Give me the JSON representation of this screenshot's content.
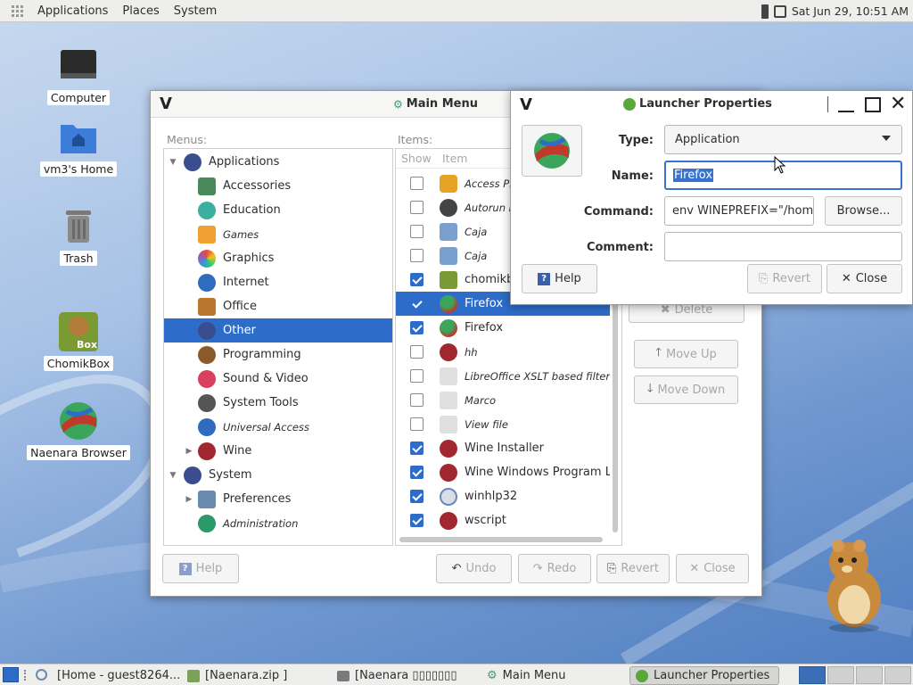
{
  "top_panel": {
    "menus": [
      "Applications",
      "Places",
      "System"
    ],
    "clock": "Sat Jun 29, 10:51 AM"
  },
  "desktop": {
    "icons": [
      {
        "label": "Computer",
        "icon": "computer-icon"
      },
      {
        "label": "vm3's Home",
        "icon": "home-folder-icon"
      },
      {
        "label": "Trash",
        "icon": "trash-icon"
      },
      {
        "label": "ChomikBox",
        "icon": "chomikbox-icon"
      },
      {
        "label": "Naenara Browser",
        "icon": "naenara-browser-icon"
      }
    ]
  },
  "main_menu": {
    "title": "Main Menu",
    "menus_label": "Menus:",
    "items_label": "Items:",
    "col_show": "Show",
    "col_item": "Item",
    "tree": [
      {
        "label": "Applications",
        "level": 0,
        "expanded": true,
        "icon": "applications-icon"
      },
      {
        "label": "Accessories",
        "level": 1,
        "icon": "accessories-icon"
      },
      {
        "label": "Education",
        "level": 1,
        "icon": "education-icon"
      },
      {
        "label": "Games",
        "level": 1,
        "icon": "games-icon",
        "italic": true
      },
      {
        "label": "Graphics",
        "level": 1,
        "icon": "graphics-icon"
      },
      {
        "label": "Internet",
        "level": 1,
        "icon": "internet-icon"
      },
      {
        "label": "Office",
        "level": 1,
        "icon": "office-icon"
      },
      {
        "label": "Other",
        "level": 1,
        "icon": "other-icon",
        "selected": true
      },
      {
        "label": "Programming",
        "level": 1,
        "icon": "programming-icon"
      },
      {
        "label": "Sound & Video",
        "level": 1,
        "icon": "sound-video-icon"
      },
      {
        "label": "System Tools",
        "level": 1,
        "icon": "system-tools-icon"
      },
      {
        "label": "Universal Access",
        "level": 1,
        "icon": "universal-access-icon",
        "italic": true
      },
      {
        "label": "Wine",
        "level": 1,
        "icon": "wine-icon",
        "collapsed": true
      },
      {
        "label": "System",
        "level": 0,
        "expanded": true,
        "icon": "system-icon"
      },
      {
        "label": "Preferences",
        "level": 1,
        "icon": "preferences-icon",
        "collapsed": true
      },
      {
        "label": "Administration",
        "level": 1,
        "icon": "administration-icon",
        "italic": true
      }
    ],
    "items": [
      {
        "label": "Access Prompt",
        "checked": false,
        "italic": true,
        "icon": "shield-icon"
      },
      {
        "label": "Autorun Prompt",
        "checked": false,
        "italic": true,
        "icon": "gear-icon"
      },
      {
        "label": "Caja",
        "checked": false,
        "italic": true,
        "icon": "folder-icon"
      },
      {
        "label": "Caja",
        "checked": false,
        "italic": true,
        "icon": "folder-icon"
      },
      {
        "label": "chomikbox",
        "checked": true,
        "icon": "chomikbox-icon"
      },
      {
        "label": "Firefox",
        "checked": true,
        "icon": "naenara-icon",
        "selected": true
      },
      {
        "label": "Firefox",
        "checked": true,
        "icon": "naenara-icon"
      },
      {
        "label": "hh",
        "checked": false,
        "italic": true,
        "icon": "wine-icon"
      },
      {
        "label": "LibreOffice XSLT based filters",
        "checked": false,
        "italic": true,
        "icon": "blank-icon"
      },
      {
        "label": "Marco",
        "checked": false,
        "italic": true,
        "icon": "blank-icon"
      },
      {
        "label": "View file",
        "checked": false,
        "italic": true,
        "icon": "blank-icon"
      },
      {
        "label": "Wine Installer",
        "checked": true,
        "icon": "wine-icon"
      },
      {
        "label": "Wine Windows Program Loader",
        "checked": true,
        "icon": "wine-icon"
      },
      {
        "label": "winhlp32",
        "checked": true,
        "icon": "help-icon"
      },
      {
        "label": "wscript",
        "checked": true,
        "icon": "wine-icon"
      }
    ],
    "side_buttons": {
      "delete": "Delete",
      "move_up": "Move Up",
      "move_down": "Move Down"
    },
    "bottom_buttons": {
      "help": "Help",
      "undo": "Undo",
      "redo": "Redo",
      "revert": "Revert",
      "close": "Close"
    }
  },
  "launcher": {
    "title": "Launcher Properties",
    "type_label": "Type:",
    "type_value": "Application",
    "name_label": "Name:",
    "name_value": "Firefox",
    "command_label": "Command:",
    "command_value": "env WINEPREFIX=\"/hom",
    "comment_label": "Comment:",
    "comment_value": "",
    "browse": "Browse...",
    "help": "Help",
    "revert": "Revert",
    "close": "Close"
  },
  "taskbar": {
    "tasks": [
      {
        "label": "[Home - guest8264...",
        "icon": "folder-icon"
      },
      {
        "label": "[Naenara.zip ]",
        "icon": "archive-icon"
      },
      {
        "label": "[Naenara ▯▯▯▯▯▯▯",
        "icon": "folder-icon"
      },
      {
        "label": "Main Menu",
        "icon": "menu-icon"
      },
      {
        "label": "Launcher Properties",
        "icon": "launcher-icon",
        "active": true
      }
    ]
  },
  "colors": {
    "selection": "#2d6dc9",
    "panel": "#eeeeec"
  }
}
